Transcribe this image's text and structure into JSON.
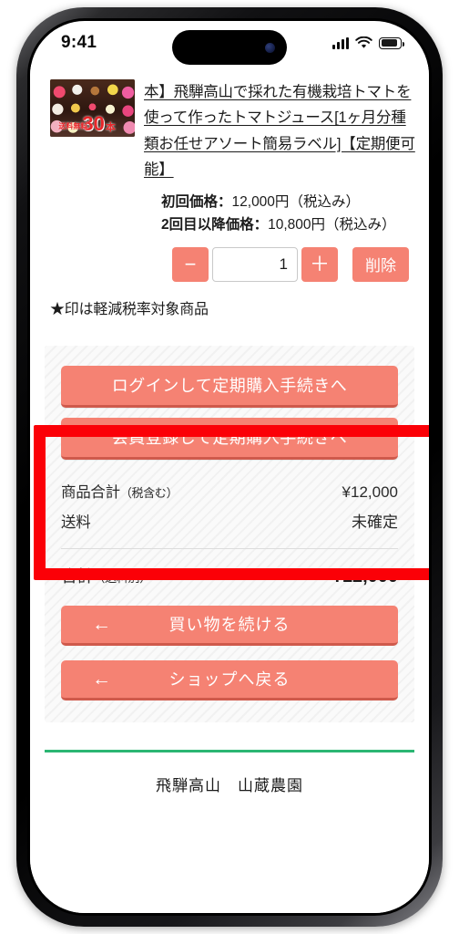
{
  "status_bar": {
    "time": "9:41",
    "icons": [
      "signal-bars-icon",
      "wifi-icon",
      "battery-icon"
    ]
  },
  "cart_item": {
    "thumbnail": {
      "badge_pre": "送料無料",
      "badge_number": "30",
      "badge_unit": "本"
    },
    "title": "本】飛騨高山で採れた有機栽培トマトを使って作ったトマトジュース[1ヶ月分種類お任せアソート簡易ラベル]【定期便可能】",
    "prices": [
      {
        "label": "初回価格：",
        "value": "12,000円",
        "tax_note": "（税込み）"
      },
      {
        "label": "2回目以降価格：",
        "value": "10,800円",
        "tax_note": "（税込み）"
      }
    ],
    "quantity": {
      "decrement_label": "−",
      "increment_label": "＋",
      "value": "1",
      "delete_label": "削除"
    }
  },
  "tax_note": "★印は軽減税率対象商品",
  "summary": {
    "cta_buttons": [
      {
        "label": "ログインして定期購入手続きへ"
      },
      {
        "label": "会員登録して定期購入手続きへ"
      }
    ],
    "rows": [
      {
        "label": "商品合計",
        "label_small": "（税含む）",
        "value": "¥12,000"
      },
      {
        "label": "送料",
        "label_small": "",
        "value": "未確定"
      }
    ],
    "total": {
      "label": "合計",
      "label_small": "（送料別）",
      "value": "¥12,000"
    },
    "nav_buttons": [
      {
        "arrow": "←",
        "label": "買い物を続ける"
      },
      {
        "arrow": "←",
        "label": "ショップへ戻る"
      }
    ]
  },
  "footer": {
    "shop_name": "飛騨高山　山蔵農園"
  },
  "annotation": {
    "color": "#fb0007"
  },
  "colors": {
    "accent": "#f58273",
    "accent_shadow": "#cf5a4c",
    "footer_rule": "#2bb673",
    "highlight": "#fb0007"
  }
}
